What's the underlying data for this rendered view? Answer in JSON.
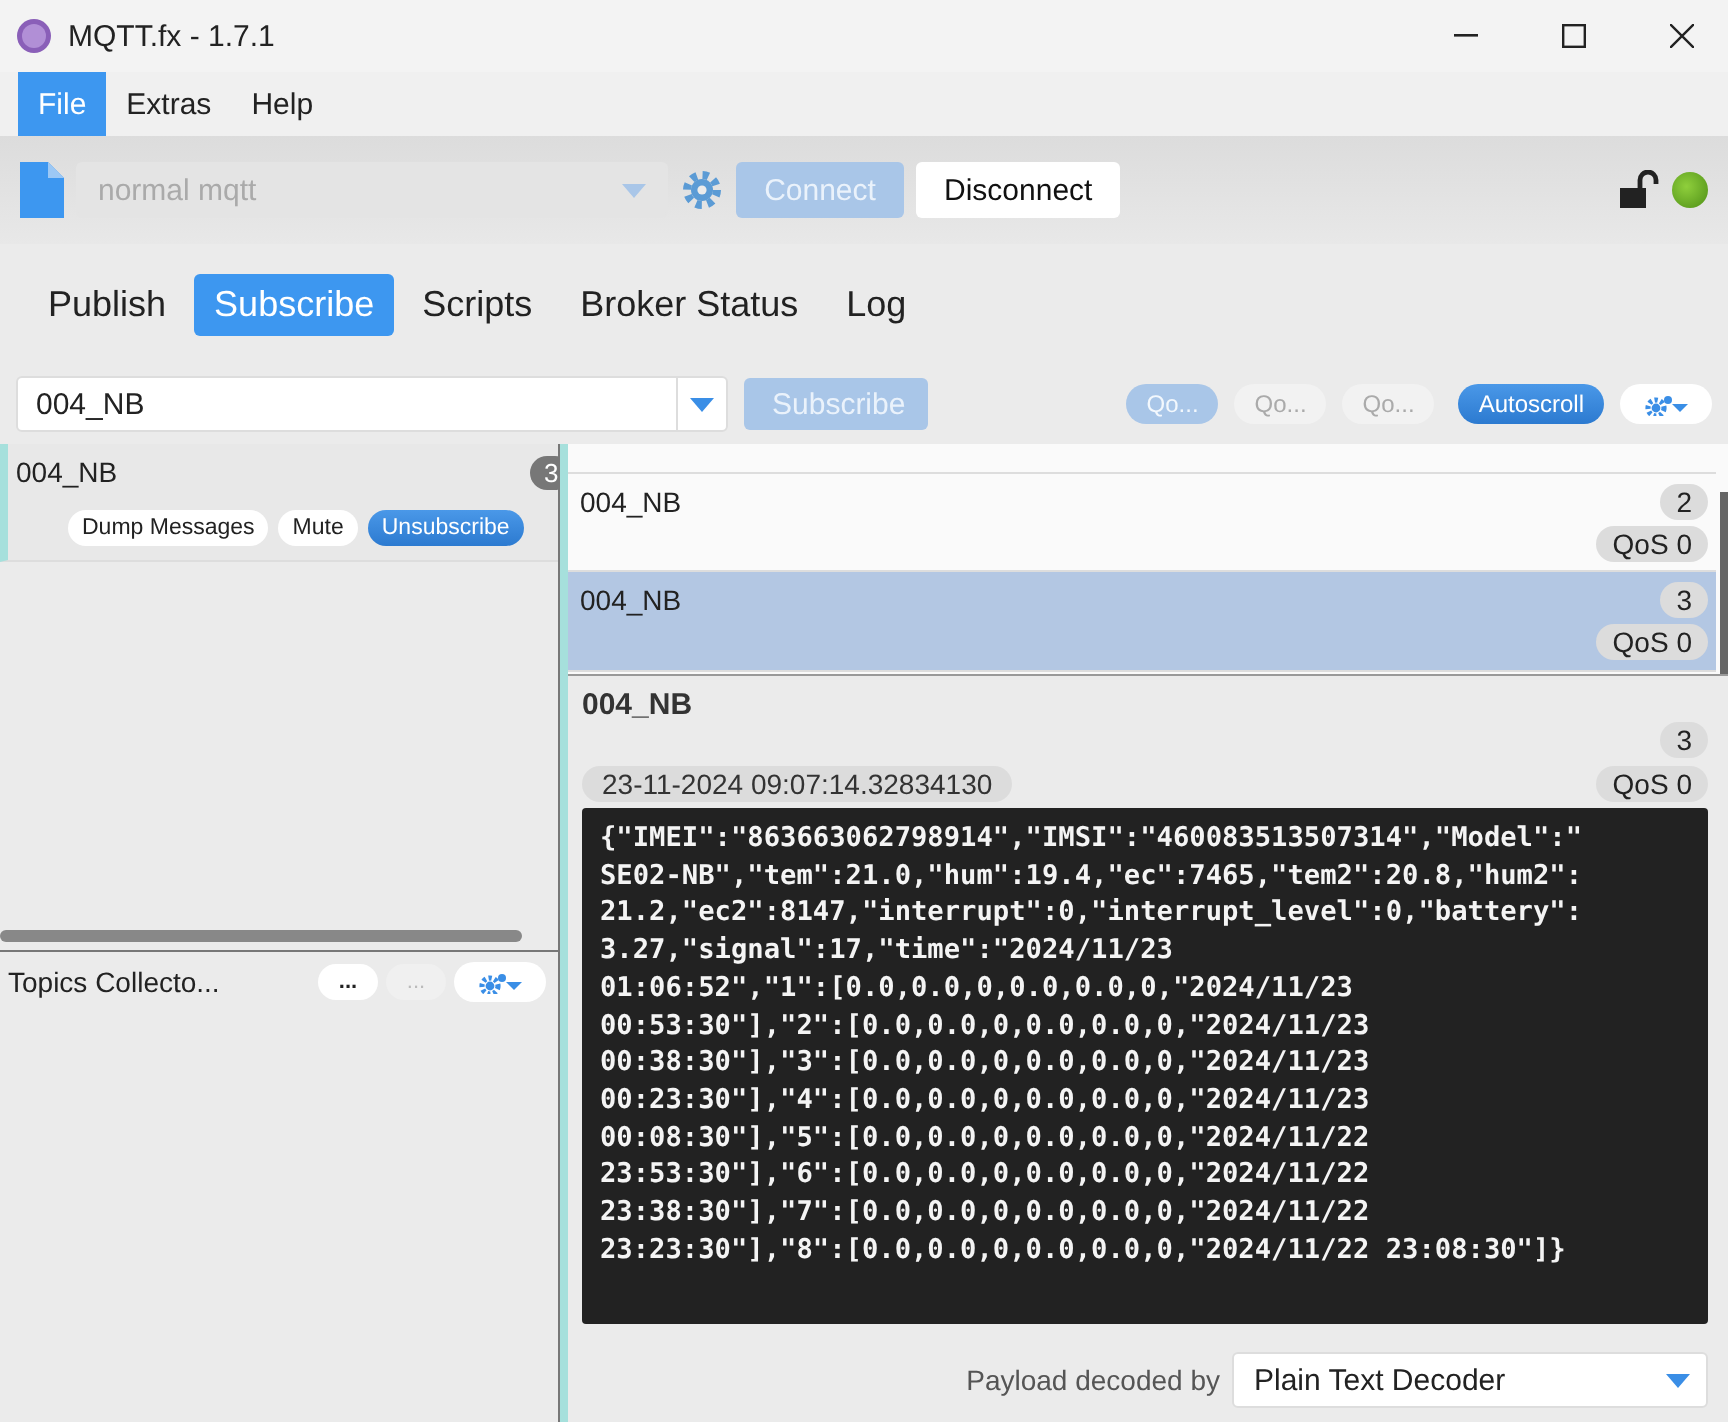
{
  "window": {
    "title": "MQTT.fx - 1.7.1"
  },
  "menu": [
    {
      "label": "File",
      "selected": true
    },
    {
      "label": "Extras",
      "selected": false
    },
    {
      "label": "Help",
      "selected": false
    }
  ],
  "toolbar": {
    "profile": {
      "value": "normal mqtt",
      "disabled": true
    },
    "connect": {
      "label": "Connect",
      "disabled": true
    },
    "disconnect": {
      "label": "Disconnect",
      "disabled": false
    },
    "status_led": {
      "on": true
    }
  },
  "tabs": [
    {
      "label": "Publish",
      "selected": false
    },
    {
      "label": "Subscribe",
      "selected": true
    },
    {
      "label": "Scripts",
      "selected": false
    },
    {
      "label": "Broker Status",
      "selected": false
    },
    {
      "label": "Log",
      "selected": false
    }
  ],
  "subscribe_bar": {
    "topic": "004_NB",
    "subscribe": {
      "label": "Subscribe",
      "disabled": true
    },
    "qos": [
      {
        "label": "Qo...",
        "selected": true
      },
      {
        "label": "Qo...",
        "selected": false
      },
      {
        "label": "Qo...",
        "selected": false
      }
    ],
    "autoscroll": {
      "label": "Autoscroll",
      "on": true
    }
  },
  "subscriptions": [
    {
      "topic": "004_NB",
      "count": "3",
      "actions": [
        "Dump Messages",
        "Mute",
        "Unsubscribe"
      ]
    }
  ],
  "topics_collector": {
    "title": "Topics Collecto...",
    "buttons": [
      {
        "label": "...",
        "disabled": false
      },
      {
        "label": "...",
        "disabled": true
      }
    ]
  },
  "messages": [
    {
      "topic": "004_NB",
      "count": "2",
      "qos": "QoS 0",
      "selected": false
    },
    {
      "topic": "004_NB",
      "count": "3",
      "qos": "QoS 0",
      "selected": true
    }
  ],
  "detail": {
    "topic": "004_NB",
    "count": "3",
    "timestamp": "23-11-2024  09:07:14.32834130",
    "qos": "QoS 0",
    "payload": "{\"IMEI\":\"863663062798914\",\"IMSI\":\"460083513507314\",\"Model\":\"\nSE02-NB\",\"tem\":21.0,\"hum\":19.4,\"ec\":7465,\"tem2\":20.8,\"hum2\":\n21.2,\"ec2\":8147,\"interrupt\":0,\"interrupt_level\":0,\"battery\":\n3.27,\"signal\":17,\"time\":\"2024/11/23\n01:06:52\",\"1\":[0.0,0.0,0,0.0,0.0,0,\"2024/11/23\n00:53:30\"],\"2\":[0.0,0.0,0,0.0,0.0,0,\"2024/11/23\n00:38:30\"],\"3\":[0.0,0.0,0,0.0,0.0,0,\"2024/11/23\n00:23:30\"],\"4\":[0.0,0.0,0,0.0,0.0,0,\"2024/11/23\n00:08:30\"],\"5\":[0.0,0.0,0,0.0,0.0,0,\"2024/11/22\n23:53:30\"],\"6\":[0.0,0.0,0,0.0,0.0,0,\"2024/11/22\n23:38:30\"],\"7\":[0.0,0.0,0,0.0,0.0,0,\"2024/11/22\n23:23:30\"],\"8\":[0.0,0.0,0,0.0,0.0,0,\"2024/11/22 23:08:30\"]}",
    "decoder_label": "Payload decoded by",
    "decoder": "Plain Text Decoder"
  }
}
